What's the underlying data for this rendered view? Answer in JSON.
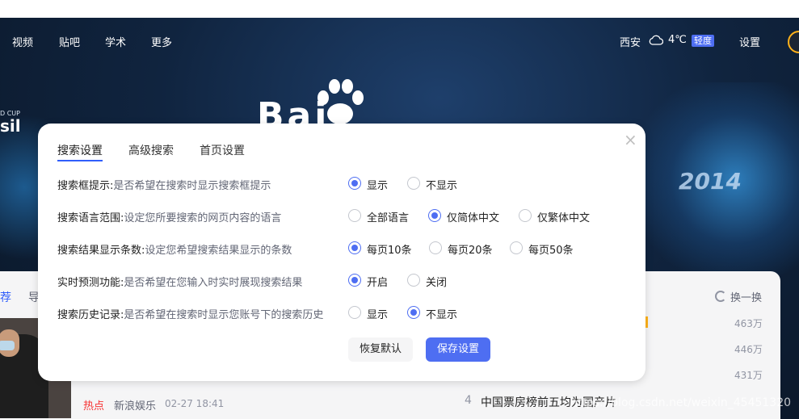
{
  "nav": {
    "left": [
      "视频",
      "贴吧",
      "学术",
      "更多"
    ],
    "city": "西安",
    "weather_icon": "cloud-icon",
    "temperature": "4℃",
    "aqi": "轻度",
    "settings": "设置"
  },
  "hero": {
    "logo": "Bai",
    "cup_small": "D CUP",
    "cup_text": "sil",
    "year": "2014"
  },
  "feed": {
    "tab_recommend": "荐",
    "tab_nav": "导",
    "refresh_label": "换一换",
    "hot_values": [
      "463万",
      "446万",
      "431万"
    ],
    "news_hot_tag": "热点",
    "news_source": "新浪娱乐",
    "news_time": "02-27 18:41",
    "hot_rank": "4",
    "hot_title": "中国票房榜前五均为国产片",
    "watermark": "https://blog.csdn.net/weixin_45451320"
  },
  "modal": {
    "close": "×",
    "tabs": [
      "搜索设置",
      "高级搜索",
      "首页设置"
    ],
    "rows": [
      {
        "key": "搜索框提示:",
        "desc": "是否希望在搜索时显示搜索框提示",
        "options": [
          "显示",
          "不显示"
        ],
        "selected": "显示"
      },
      {
        "key": "搜索语言范围:",
        "desc": "设定您所要搜索的网页内容的语言",
        "options": [
          "全部语言",
          "仅简体中文",
          "仅繁体中文"
        ],
        "selected": "仅简体中文"
      },
      {
        "key": "搜索结果显示条数:",
        "desc": "设定您希望搜索结果显示的条数",
        "options": [
          "每页10条",
          "每页20条",
          "每页50条"
        ],
        "selected": "每页10条"
      },
      {
        "key": "实时预测功能:",
        "desc": "是否希望在您输入时实时展现搜索结果",
        "options": [
          "开启",
          "关闭"
        ],
        "selected": "开启"
      },
      {
        "key": "搜索历史记录:",
        "desc": "是否希望在搜索时显示您账号下的搜索历史",
        "options": [
          "显示",
          "不显示"
        ],
        "selected": "不显示"
      }
    ],
    "reset_label": "恢复默认",
    "save_label": "保存设置"
  },
  "colors": {
    "accent": "#4e6ef2",
    "tab_active": "#315efb",
    "hot": "#f73131"
  }
}
